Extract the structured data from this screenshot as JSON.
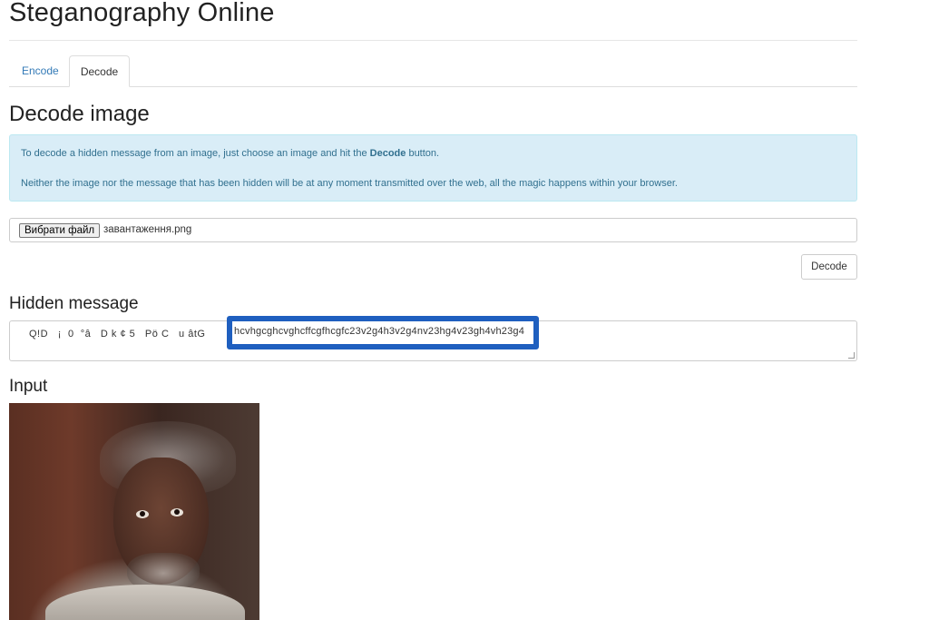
{
  "site": {
    "title": "Steganography Online"
  },
  "tabs": [
    {
      "label": "Encode",
      "active": false
    },
    {
      "label": "Decode",
      "active": true
    }
  ],
  "decode": {
    "heading": "Decode image",
    "info_line1_pre": "To decode a hidden message from an image, just choose an image and hit the ",
    "info_line1_bold": "Decode",
    "info_line1_post": " button.",
    "info_line2": "Neither the image nor the message that has been hidden will be at any moment transmitted over the web, all the magic happens within your browser.",
    "file_button_label": "Вибрати файл",
    "file_name": "завантаження.png",
    "decode_button_label": "Decode"
  },
  "hidden_message": {
    "heading": "Hidden message",
    "garbled_prefix": "Q!D   ¡  0  °â   D k ¢ 5   Pö C   u âtG",
    "highlighted_text": "hcvhgcghcvghcffcgfhcgfc23v2g4h3v2g4nv23hg4v23gh4vh23g4"
  },
  "input_section": {
    "heading": "Input"
  },
  "colors": {
    "link": "#337ab7",
    "alert_bg": "#d9edf7",
    "alert_text": "#31708f",
    "highlight_border": "#1f5fbf"
  }
}
